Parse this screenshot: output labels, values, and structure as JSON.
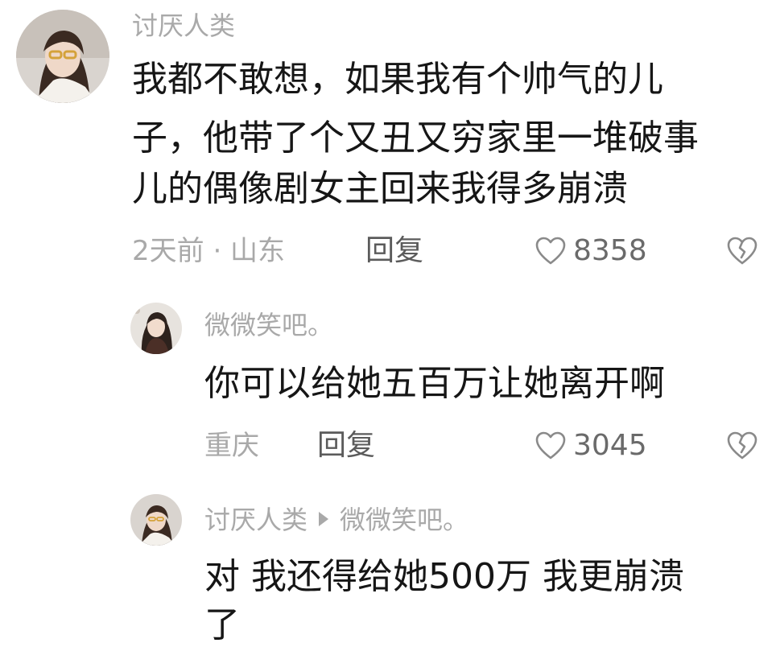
{
  "comment": {
    "author": "讨厌人类",
    "text_lines": [
      "我都不敢想，如果我有个帅气的儿",
      "子，他带了个又丑又穷家里一堆破事",
      "儿的偶像剧女主回来我得多崩溃"
    ],
    "time_location": "2天前 · 山东",
    "reply_label": "回复",
    "likes": "8358",
    "like_icon": "heart-outline-icon",
    "dislike_icon": "broken-heart-icon"
  },
  "replies": [
    {
      "author": "微微笑吧。",
      "text_lines": [
        "你可以给她五百万让她离开啊"
      ],
      "location": "重庆",
      "reply_label": "回复",
      "likes": "3045"
    },
    {
      "author": "讨厌人类",
      "reply_to": "微微笑吧。",
      "text_lines": [
        "对 我还得给她500万 我更崩溃",
        "了"
      ]
    }
  ],
  "colors": {
    "meta": "#a9a9a9",
    "text": "#161616",
    "reply": "#5b5b5b"
  }
}
